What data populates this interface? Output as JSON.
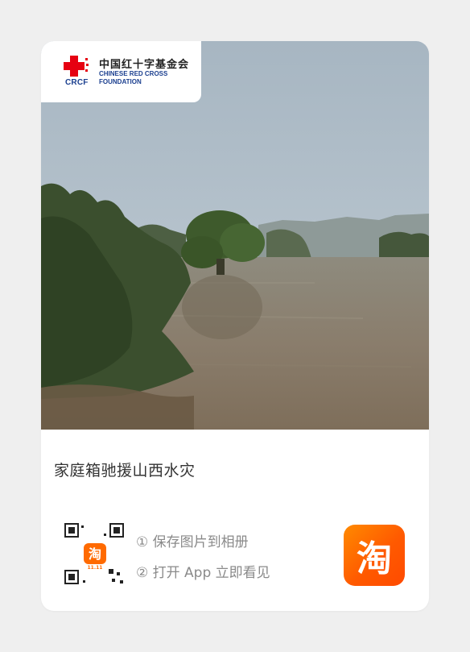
{
  "logo": {
    "abbr": "CRCF",
    "name_cn": "中国红十字基金会",
    "name_en_line1": "CHINESE RED CROSS",
    "name_en_line2": "FOUNDATION",
    "cross_color": "#e60012"
  },
  "post": {
    "title": "家庭箱驰援山西水灾"
  },
  "share": {
    "step1": "① 保存图片到相册",
    "step2": "② 打开 App 立即看见",
    "qr_center_glyph": "淘",
    "qr_center_subtext": "11.11"
  },
  "app_icon": {
    "glyph": "淘",
    "color": "#ff5a00"
  }
}
